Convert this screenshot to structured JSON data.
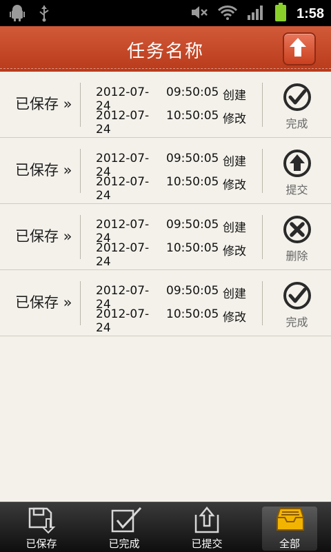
{
  "statusbar": {
    "time": "1:58"
  },
  "header": {
    "title": "任务名称"
  },
  "rows": [
    {
      "status": "已保存 »",
      "created_date": "2012-07-24",
      "created_time": "09:50:05",
      "created_label": "创建",
      "modified_date": "2012-07-24",
      "modified_time": "10:50:05",
      "modified_label": "修改",
      "action_label": "完成",
      "action_icon": "check-circle-icon"
    },
    {
      "status": "已保存 »",
      "created_date": "2012-07-24",
      "created_time": "09:50:05",
      "created_label": "创建",
      "modified_date": "2012-07-24",
      "modified_time": "10:50:05",
      "modified_label": "修改",
      "action_label": "提交",
      "action_icon": "arrow-up-circle-icon"
    },
    {
      "status": "已保存 »",
      "created_date": "2012-07-24",
      "created_time": "09:50:05",
      "created_label": "创建",
      "modified_date": "2012-07-24",
      "modified_time": "10:50:05",
      "modified_label": "修改",
      "action_label": "删除",
      "action_icon": "x-circle-icon"
    },
    {
      "status": "已保存 »",
      "created_date": "2012-07-24",
      "created_time": "09:50:05",
      "created_label": "创建",
      "modified_date": "2012-07-24",
      "modified_time": "10:50:05",
      "modified_label": "修改",
      "action_label": "完成",
      "action_icon": "check-circle-icon"
    }
  ],
  "bottom_nav": [
    {
      "label": "已保存",
      "icon": "save-down-icon"
    },
    {
      "label": "已完成",
      "icon": "checkbox-icon"
    },
    {
      "label": "已提交",
      "icon": "upload-box-icon"
    },
    {
      "label": "全部",
      "icon": "tray-icon",
      "active": true
    }
  ],
  "colors": {
    "header": "#c44a2a",
    "background": "#f3f1ea",
    "active_icon": "#f2b400"
  }
}
